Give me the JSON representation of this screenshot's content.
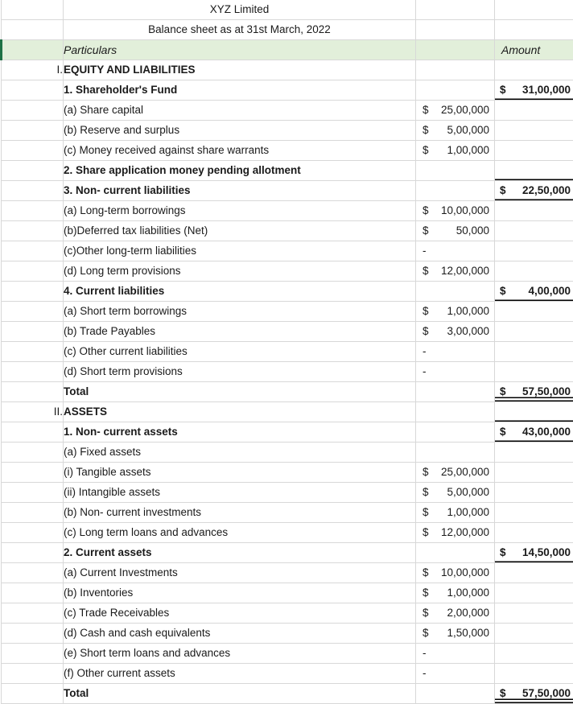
{
  "document": {
    "company_name": "XYZ Limited",
    "statement_title": "Balance sheet as at 31st March, 2022"
  },
  "columns": {
    "particulars": "Particulars",
    "amount": "Amount"
  },
  "colors": {
    "header_fill": "#E2EFDA",
    "header_accent": "#1E7145",
    "grid_line": "#D8D8D8",
    "text": "#1A1A1A"
  },
  "rows": [
    {
      "num": "I.",
      "label": "EQUITY AND LIABILITIES",
      "bold": true,
      "indent": 0,
      "detail": "",
      "amount": "",
      "style": "section"
    },
    {
      "num": "",
      "label": "1. Shareholder's Fund",
      "bold": true,
      "indent": 0,
      "detail": "",
      "amount": "$31,00,000",
      "style": "subtotal"
    },
    {
      "num": "",
      "label": "(a) Share capital",
      "bold": false,
      "indent": 0,
      "detail": "$25,00,000",
      "amount": "",
      "style": "item"
    },
    {
      "num": "",
      "label": "(b) Reserve and surplus",
      "bold": false,
      "indent": 0,
      "detail": "$  5,00,000",
      "amount": "",
      "style": "item"
    },
    {
      "num": "",
      "label": "(c) Money received against share warrants",
      "bold": false,
      "indent": 0,
      "detail": "$  1,00,000",
      "amount": "",
      "style": "item"
    },
    {
      "num": "",
      "label": "2. Share application money pending allotment",
      "bold": true,
      "indent": 0,
      "detail": "",
      "amount": "",
      "style": "header-line"
    },
    {
      "num": "",
      "label": "3. Non- current liabilities",
      "bold": true,
      "indent": 0,
      "detail": "",
      "amount": "$22,50,000",
      "style": "subtotal"
    },
    {
      "num": "",
      "label": "(a) Long-term borrowings",
      "bold": false,
      "indent": 0,
      "detail": "$10,00,000",
      "amount": "",
      "style": "item"
    },
    {
      "num": "",
      "label": "(b)Deferred tax liabilities (Net)",
      "bold": false,
      "indent": 0,
      "detail": "$     50,000",
      "amount": "",
      "style": "item"
    },
    {
      "num": "",
      "label": "(c)Other long-term liabilities",
      "bold": false,
      "indent": 0,
      "detail": "-",
      "amount": "",
      "style": "item"
    },
    {
      "num": "",
      "label": "(d) Long term provisions",
      "bold": false,
      "indent": 0,
      "detail": "$12,00,000",
      "amount": "",
      "style": "item"
    },
    {
      "num": "",
      "label": "4. Current liabilities",
      "bold": true,
      "indent": 0,
      "detail": "",
      "amount": "$  4,00,000",
      "style": "subtotal"
    },
    {
      "num": "",
      "label": "(a) Short term borrowings",
      "bold": false,
      "indent": 0,
      "detail": "$  1,00,000",
      "amount": "",
      "style": "item"
    },
    {
      "num": "",
      "label": "(b) Trade Payables",
      "bold": false,
      "indent": 0,
      "detail": "$  3,00,000",
      "amount": "",
      "style": "item"
    },
    {
      "num": "",
      "label": "(c) Other current liabilities",
      "bold": false,
      "indent": 0,
      "detail": "-",
      "amount": "",
      "style": "item"
    },
    {
      "num": "",
      "label": "(d) Short term provisions",
      "bold": false,
      "indent": 0,
      "detail": "-",
      "amount": "",
      "style": "item"
    },
    {
      "num": "",
      "label": "Total",
      "bold": true,
      "indent": 0,
      "detail": "",
      "amount": "$57,50,000",
      "style": "grandtotal"
    },
    {
      "num": "II.",
      "label": "ASSETS",
      "bold": true,
      "indent": 0,
      "detail": "",
      "amount": "",
      "style": "section"
    },
    {
      "num": "",
      "label": "1. Non- current assets",
      "bold": true,
      "indent": 0,
      "detail": "",
      "amount": "$43,00,000",
      "style": "subtotal"
    },
    {
      "num": "",
      "label": "(a) Fixed assets",
      "bold": false,
      "indent": 0,
      "detail": "",
      "amount": "",
      "style": "item"
    },
    {
      "num": "",
      "label": "(i) Tangible assets",
      "bold": false,
      "indent": 1,
      "detail": "$25,00,000",
      "amount": "",
      "style": "item"
    },
    {
      "num": "",
      "label": "(ii) Intangible assets",
      "bold": false,
      "indent": 1,
      "detail": "$  5,00,000",
      "amount": "",
      "style": "item"
    },
    {
      "num": "",
      "label": "(b) Non- current investments",
      "bold": false,
      "indent": 0,
      "detail": "$  1,00,000",
      "amount": "",
      "style": "item"
    },
    {
      "num": "",
      "label": "(c) Long term loans and advances",
      "bold": false,
      "indent": 0,
      "detail": "$12,00,000",
      "amount": "",
      "style": "item"
    },
    {
      "num": "",
      "label": "2. Current assets",
      "bold": true,
      "indent": 0,
      "detail": "",
      "amount": "$14,50,000",
      "style": "subtotal"
    },
    {
      "num": "",
      "label": "(a) Current Investments",
      "bold": false,
      "indent": 0,
      "detail": "$10,00,000",
      "amount": "",
      "style": "item"
    },
    {
      "num": "",
      "label": "(b) Inventories",
      "bold": false,
      "indent": 0,
      "detail": "$  1,00,000",
      "amount": "",
      "style": "item"
    },
    {
      "num": "",
      "label": "(c) Trade Receivables",
      "bold": false,
      "indent": 0,
      "detail": "$  2,00,000",
      "amount": "",
      "style": "item"
    },
    {
      "num": "",
      "label": "(d) Cash and cash equivalents",
      "bold": false,
      "indent": 0,
      "detail": "$  1,50,000",
      "amount": "",
      "style": "item"
    },
    {
      "num": "",
      "label": "(e) Short term loans and advances",
      "bold": false,
      "indent": 0,
      "detail": "-",
      "amount": "",
      "style": "item"
    },
    {
      "num": "",
      "label": "(f) Other current assets",
      "bold": false,
      "indent": 0,
      "detail": "-",
      "amount": "",
      "style": "item"
    },
    {
      "num": "",
      "label": "Total",
      "bold": true,
      "indent": 0,
      "detail": "",
      "amount": "$57,50,000",
      "style": "grandtotal"
    }
  ]
}
